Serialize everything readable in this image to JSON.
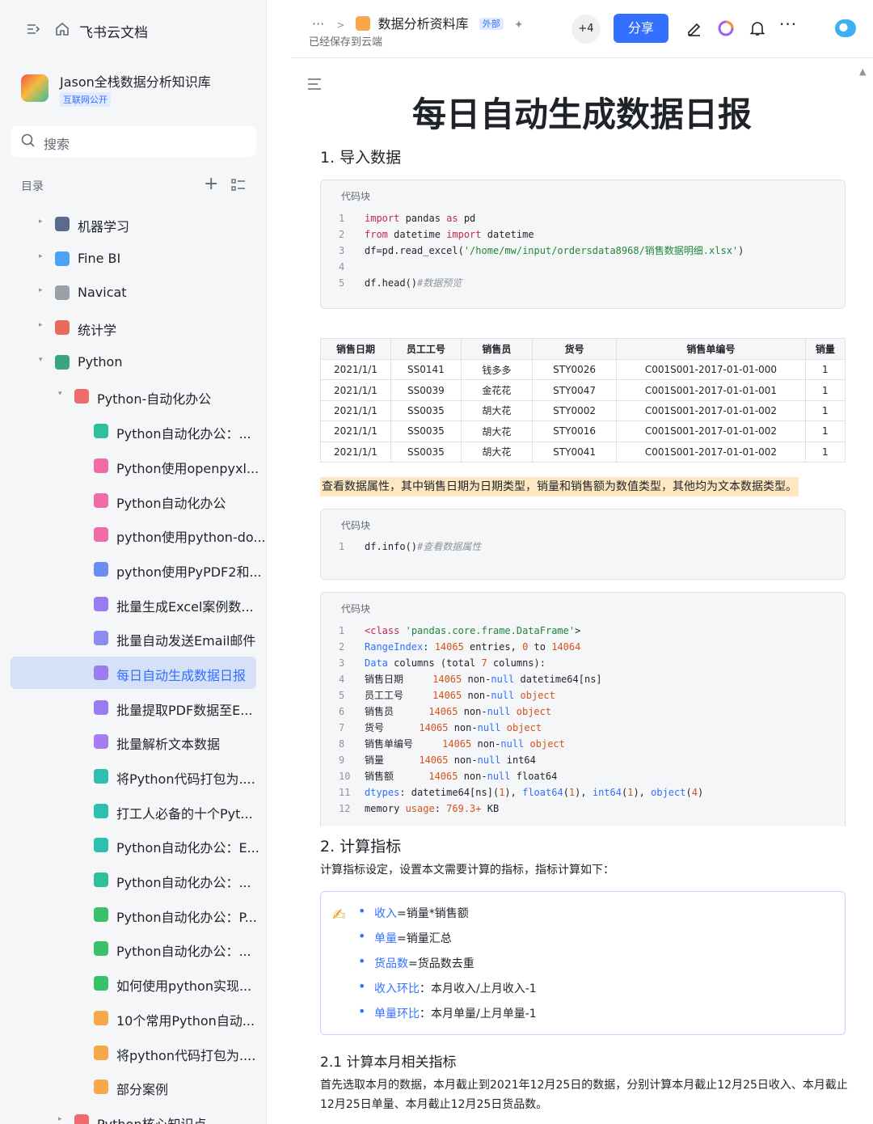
{
  "app": {
    "name": "飞书云文档"
  },
  "space": {
    "name": "Jason全栈数据分析知识库",
    "tag": "互联网公开"
  },
  "search": {
    "placeholder": "搜索"
  },
  "toc": {
    "label": "目录",
    "add": "+",
    "items": [
      {
        "label": "机器学习",
        "level": 0,
        "arrow": "▸",
        "icon": "robot-icon",
        "color": "#5b6b8c"
      },
      {
        "label": "Fine BI",
        "level": 0,
        "arrow": "▸",
        "icon": "globe-icon",
        "color": "#4ba3f5"
      },
      {
        "label": "Navicat",
        "level": 0,
        "arrow": "▸",
        "icon": "gear-icon",
        "color": "#9aa0a8"
      },
      {
        "label": "统计学",
        "level": 0,
        "arrow": "▸",
        "icon": "chart-icon",
        "color": "#e86a5c"
      },
      {
        "label": "Python",
        "level": 0,
        "arrow": "▾",
        "icon": "python-icon",
        "color": "#3aa57a"
      },
      {
        "label": "Python-自动化办公",
        "level": 1,
        "arrow": "▾",
        "icon": "folder-icon",
        "color": "#f06b6b"
      },
      {
        "label": "Python自动化办公：...",
        "level": 2,
        "arrow": "",
        "icon": "doc-icon",
        "color": "#2fbf9a"
      },
      {
        "label": "Python使用openpyxl...",
        "level": 2,
        "arrow": "",
        "icon": "doc-icon",
        "color": "#f06ba8"
      },
      {
        "label": "Python自动化办公",
        "level": 2,
        "arrow": "",
        "icon": "doc-icon",
        "color": "#f06ba8"
      },
      {
        "label": "python使用python-do...",
        "level": 2,
        "arrow": "",
        "icon": "doc-icon",
        "color": "#f06ba8"
      },
      {
        "label": "python使用PyPDF2和...",
        "level": 2,
        "arrow": "",
        "icon": "doc-icon",
        "color": "#6b8cf0"
      },
      {
        "label": "批量生成Excel案例数...",
        "level": 2,
        "arrow": "",
        "icon": "doc-icon",
        "color": "#9b7cf0"
      },
      {
        "label": "批量自动发送Email邮件",
        "level": 2,
        "arrow": "",
        "icon": "doc-icon",
        "color": "#8b8cf0"
      },
      {
        "label": "每日自动生成数据日报",
        "level": 2,
        "arrow": "",
        "icon": "doc-icon",
        "color": "#9b7cf0",
        "active": true
      },
      {
        "label": "批量提取PDF数据至E...",
        "level": 2,
        "arrow": "",
        "icon": "doc-icon",
        "color": "#9b7cf0"
      },
      {
        "label": "批量解析文本数据",
        "level": 2,
        "arrow": "",
        "icon": "doc-icon",
        "color": "#a77cf0"
      },
      {
        "label": "将Python代码打包为....",
        "level": 2,
        "arrow": "",
        "icon": "doc-icon",
        "color": "#2fbfae"
      },
      {
        "label": "打工人必备的十个Pyt...",
        "level": 2,
        "arrow": "",
        "icon": "doc-icon",
        "color": "#2fbfae"
      },
      {
        "label": "Python自动化办公：E...",
        "level": 2,
        "arrow": "",
        "icon": "doc-icon",
        "color": "#2fbfae"
      },
      {
        "label": "Python自动化办公：...",
        "level": 2,
        "arrow": "",
        "icon": "doc-icon",
        "color": "#2fbf9a"
      },
      {
        "label": "Python自动化办公：P...",
        "level": 2,
        "arrow": "",
        "icon": "doc-icon",
        "color": "#3ac06b"
      },
      {
        "label": "Python自动化办公：...",
        "level": 2,
        "arrow": "",
        "icon": "doc-icon",
        "color": "#3ac06b"
      },
      {
        "label": "如何使用python实现...",
        "level": 2,
        "arrow": "",
        "icon": "doc-icon",
        "color": "#3ac06b"
      },
      {
        "label": "10个常用Python自动...",
        "level": 2,
        "arrow": "",
        "icon": "doc-icon",
        "color": "#f7a84a"
      },
      {
        "label": "将python代码打包为....",
        "level": 2,
        "arrow": "",
        "icon": "doc-icon",
        "color": "#f7a84a"
      },
      {
        "label": "部分案例",
        "level": 2,
        "arrow": "",
        "icon": "doc-icon",
        "color": "#f7a84a"
      },
      {
        "label": "Python核心知识点",
        "level": 1,
        "arrow": "▸",
        "icon": "folder-icon",
        "color": "#f06b6b"
      }
    ]
  },
  "header": {
    "dots": "···",
    "sep": ">",
    "library": "数据分析资料库",
    "ext_tag": "外部",
    "saved": "已经保存到云端",
    "avatars": "+4",
    "share": "分享",
    "more": "···"
  },
  "doc": {
    "title": "每日自动生成数据日报",
    "h_import": "1. 导入数据",
    "code_caption": "代码块",
    "table": {
      "headers": [
        "销售日期",
        "员工工号",
        "销售员",
        "货号",
        "销售单编号",
        "销量"
      ],
      "rows": [
        [
          "2021/1/1",
          "SS0141",
          "钱多多",
          "STY0026",
          "C001S001-2017-01-01-000",
          "1"
        ],
        [
          "2021/1/1",
          "SS0039",
          "金花花",
          "STY0047",
          "C001S001-2017-01-01-001",
          "1"
        ],
        [
          "2021/1/1",
          "SS0035",
          "胡大花",
          "STY0002",
          "C001S001-2017-01-01-002",
          "1"
        ],
        [
          "2021/1/1",
          "SS0035",
          "胡大花",
          "STY0016",
          "C001S001-2017-01-01-002",
          "1"
        ],
        [
          "2021/1/1",
          "SS0035",
          "胡大花",
          "STY0041",
          "C001S001-2017-01-01-002",
          "1"
        ]
      ]
    },
    "highlight_text": "查看数据属性，其中销售日期为日期类型，销量和销售额为数值类型，其他均为文本数据类型。",
    "h_calc": "2. 计算指标",
    "calc_intro": "计算指标设定，设置本文需要计算的指标，指标计算如下：",
    "metrics": [
      {
        "key": "收入",
        "rest": "=销量*销售额"
      },
      {
        "key": "单量",
        "rest": "=销量汇总"
      },
      {
        "key": "货品数",
        "rest": "=货品数去重"
      },
      {
        "key": "收入环比",
        "rest": "：本月收入/上月收入-1"
      },
      {
        "key": "单量环比",
        "rest": "：本月单量/上月单量-1"
      }
    ],
    "h_calc_21": "2.1 计算本月相关指标",
    "calc_21_text": "首先选取本月的数据，本月截止到2021年12月25日的数据，分别计算本月截止12月25日收入、本月截止12月25日单量、本月截止12月25日货品数。"
  },
  "code1": {
    "lines": [
      {
        "n": "1",
        "parts": [
          [
            "kw",
            "import"
          ],
          [
            "",
            " pandas "
          ],
          [
            "kw",
            "as"
          ],
          [
            "",
            " pd"
          ]
        ]
      },
      {
        "n": "2",
        "parts": [
          [
            "kw",
            "from"
          ],
          [
            "",
            " datetime "
          ],
          [
            "kw",
            "import"
          ],
          [
            "",
            " datetime"
          ]
        ]
      },
      {
        "n": "3",
        "parts": [
          [
            "",
            "df=pd.read_excel("
          ],
          [
            "str",
            "'/home/mw/input/ordersdata8968/销售数据明细.xlsx'"
          ],
          [
            "",
            ")"
          ]
        ]
      },
      {
        "n": "4",
        "parts": [
          [
            "",
            ""
          ]
        ]
      },
      {
        "n": "5",
        "parts": [
          [
            "",
            "df.head()"
          ],
          [
            "cm",
            "#数据预览"
          ]
        ]
      }
    ]
  },
  "code2": {
    "lines": [
      {
        "n": "1",
        "parts": [
          [
            "",
            "df.info()"
          ],
          [
            "cm",
            "#查看数据属性"
          ]
        ]
      }
    ]
  },
  "code3": {
    "lines": [
      {
        "n": "1",
        "parts": [
          [
            "kw",
            "<class"
          ],
          [
            "",
            " "
          ],
          [
            "str",
            "'pandas.core.frame.DataFrame'"
          ],
          [
            "",
            ">"
          ]
        ]
      },
      {
        "n": "2",
        "parts": [
          [
            "ty",
            "RangeIndex"
          ],
          [
            "",
            ": "
          ],
          [
            "num",
            "14065"
          ],
          [
            "",
            " entries, "
          ],
          [
            "num",
            "0"
          ],
          [
            "",
            " to "
          ],
          [
            "num",
            "14064"
          ]
        ]
      },
      {
        "n": "3",
        "parts": [
          [
            "ty",
            "Data"
          ],
          [
            "",
            " columns (total "
          ],
          [
            "num",
            "7"
          ],
          [
            "",
            " columns):"
          ]
        ]
      },
      {
        "n": "4",
        "parts": [
          [
            "",
            "销售日期     "
          ],
          [
            "num",
            "14065"
          ],
          [
            "",
            " non-"
          ],
          [
            "ty",
            "null"
          ],
          [
            "",
            " datetime64[ns]"
          ]
        ]
      },
      {
        "n": "5",
        "parts": [
          [
            "",
            "员工工号     "
          ],
          [
            "num",
            "14065"
          ],
          [
            "",
            " non-"
          ],
          [
            "ty",
            "null"
          ],
          [
            "",
            " "
          ],
          [
            "kw2",
            "object"
          ]
        ]
      },
      {
        "n": "6",
        "parts": [
          [
            "",
            "销售员      "
          ],
          [
            "num",
            "14065"
          ],
          [
            "",
            " non-"
          ],
          [
            "ty",
            "null"
          ],
          [
            "",
            " "
          ],
          [
            "kw2",
            "object"
          ]
        ]
      },
      {
        "n": "7",
        "parts": [
          [
            "",
            "货号      "
          ],
          [
            "num",
            "14065"
          ],
          [
            "",
            " non-"
          ],
          [
            "ty",
            "null"
          ],
          [
            "",
            " "
          ],
          [
            "kw2",
            "object"
          ]
        ]
      },
      {
        "n": "8",
        "parts": [
          [
            "",
            "销售单编号     "
          ],
          [
            "num",
            "14065"
          ],
          [
            "",
            " non-"
          ],
          [
            "ty",
            "null"
          ],
          [
            "",
            " "
          ],
          [
            "kw2",
            "object"
          ]
        ]
      },
      {
        "n": "9",
        "parts": [
          [
            "",
            "销量      "
          ],
          [
            "num",
            "14065"
          ],
          [
            "",
            " non-"
          ],
          [
            "ty",
            "null"
          ],
          [
            "",
            " int64"
          ]
        ]
      },
      {
        "n": "10",
        "parts": [
          [
            "",
            "销售额      "
          ],
          [
            "num",
            "14065"
          ],
          [
            "",
            " non-"
          ],
          [
            "ty",
            "null"
          ],
          [
            "",
            " float64"
          ]
        ]
      },
      {
        "n": "11",
        "parts": [
          [
            "ty",
            "dtypes"
          ],
          [
            "",
            ": datetime64[ns]("
          ],
          [
            "num",
            "1"
          ],
          [
            "",
            "), "
          ],
          [
            "ty",
            "float64"
          ],
          [
            "",
            "("
          ],
          [
            "num",
            "1"
          ],
          [
            "",
            "), "
          ],
          [
            "ty",
            "int64"
          ],
          [
            "",
            "("
          ],
          [
            "num",
            "1"
          ],
          [
            "",
            "), "
          ],
          [
            "ty",
            "object"
          ],
          [
            "",
            "("
          ],
          [
            "num",
            "4"
          ],
          [
            "",
            ")"
          ]
        ]
      },
      {
        "n": "12",
        "parts": [
          [
            "",
            "memory "
          ],
          [
            "kw2",
            "usage"
          ],
          [
            "",
            ": "
          ],
          [
            "num",
            "769.3+"
          ],
          [
            "",
            " KB"
          ]
        ]
      }
    ]
  }
}
